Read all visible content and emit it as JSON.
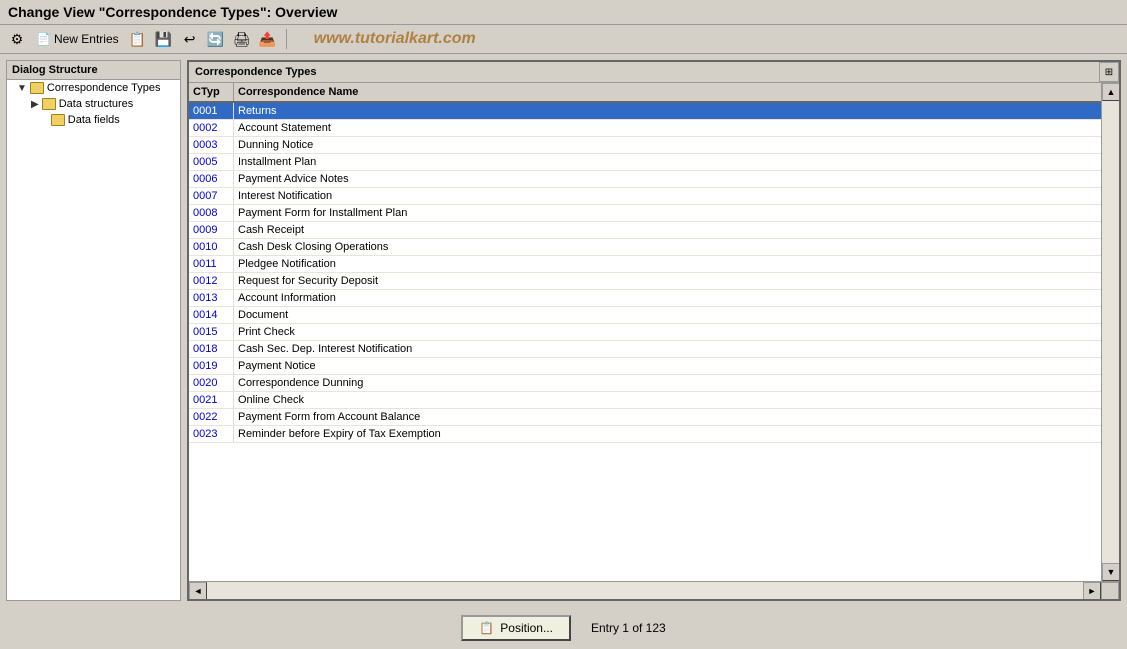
{
  "title": "Change View \"Correspondence Types\": Overview",
  "toolbar": {
    "new_entries_label": "New Entries",
    "watermark": "www.tutorialkart.com"
  },
  "dialog_structure": {
    "header": "Dialog Structure",
    "items": [
      {
        "id": "correspondence-types",
        "label": "Correspondence Types",
        "level": 1,
        "arrow": "▼",
        "selected": true
      },
      {
        "id": "data-structures",
        "label": "Data structures",
        "level": 2,
        "arrow": "▶"
      },
      {
        "id": "data-fields",
        "label": "Data fields",
        "level": 3,
        "arrow": ""
      }
    ]
  },
  "table": {
    "title": "Correspondence Types",
    "col_ctyp": "CTyp",
    "col_name": "Correspondence Name",
    "rows": [
      {
        "ctyp": "0001",
        "name": "Returns",
        "selected": true
      },
      {
        "ctyp": "0002",
        "name": "Account Statement"
      },
      {
        "ctyp": "0003",
        "name": "Dunning Notice"
      },
      {
        "ctyp": "0005",
        "name": "Installment Plan"
      },
      {
        "ctyp": "0006",
        "name": "Payment Advice Notes"
      },
      {
        "ctyp": "0007",
        "name": "Interest Notification"
      },
      {
        "ctyp": "0008",
        "name": "Payment Form for Installment Plan"
      },
      {
        "ctyp": "0009",
        "name": "Cash Receipt"
      },
      {
        "ctyp": "0010",
        "name": "Cash Desk Closing Operations"
      },
      {
        "ctyp": "0011",
        "name": "Pledgee Notification"
      },
      {
        "ctyp": "0012",
        "name": "Request for Security Deposit"
      },
      {
        "ctyp": "0013",
        "name": "Account Information"
      },
      {
        "ctyp": "0014",
        "name": "Document"
      },
      {
        "ctyp": "0015",
        "name": "Print Check"
      },
      {
        "ctyp": "0018",
        "name": "Cash Sec. Dep. Interest Notification"
      },
      {
        "ctyp": "0019",
        "name": "Payment Notice"
      },
      {
        "ctyp": "0020",
        "name": "Correspondence Dunning"
      },
      {
        "ctyp": "0021",
        "name": "Online Check"
      },
      {
        "ctyp": "0022",
        "name": "Payment Form from Account Balance"
      },
      {
        "ctyp": "0023",
        "name": "Reminder before Expiry of Tax Exemption"
      }
    ]
  },
  "bottom": {
    "position_btn_label": "Position...",
    "entry_info": "Entry 1 of 123"
  }
}
